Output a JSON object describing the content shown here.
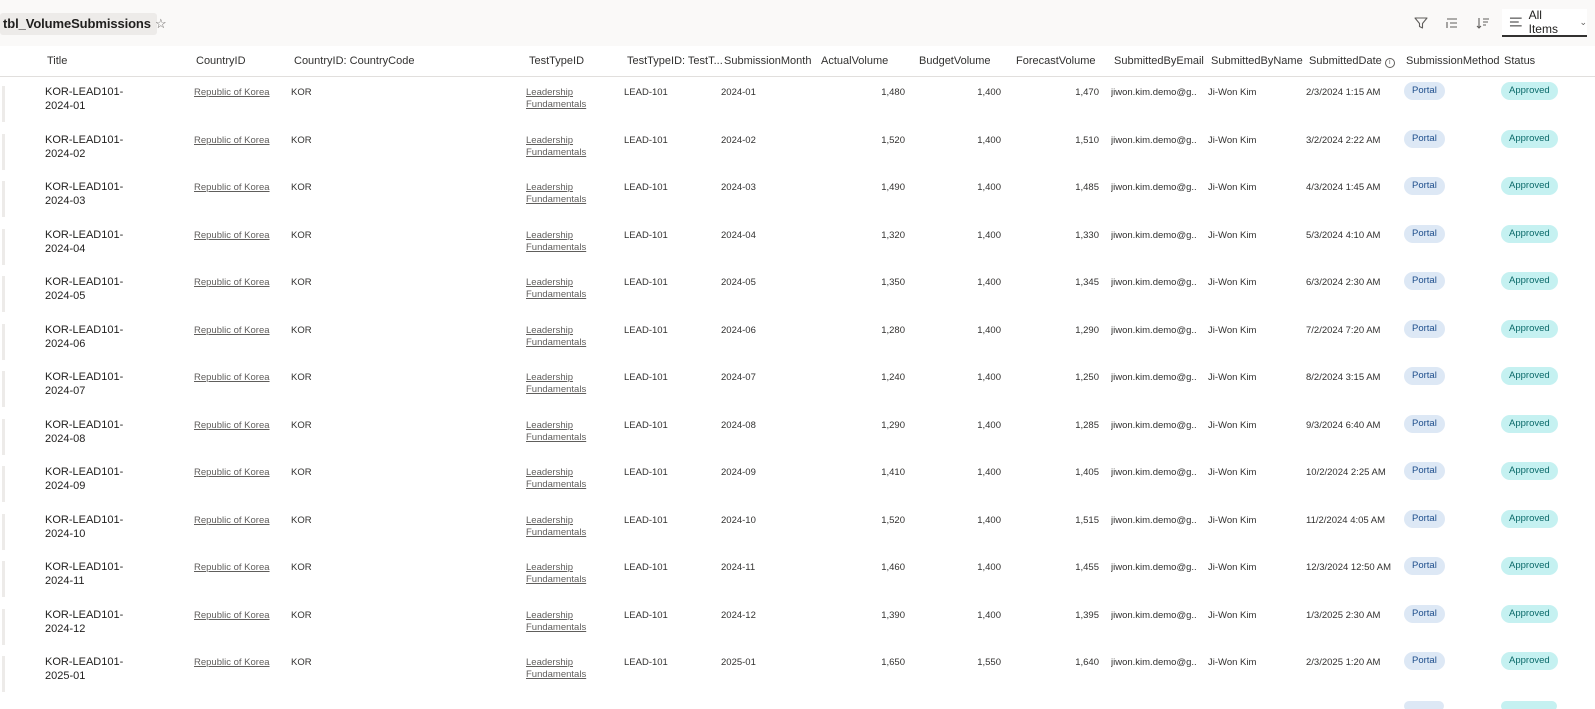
{
  "header": {
    "list_title": "tbl_VolumeSubmissions",
    "favorite_glyph": "☆",
    "view_label": "All Items",
    "icons": [
      "filter-icon",
      "group-by-icon",
      "sort-icon",
      "view-list-icon",
      "chevron-down-icon"
    ]
  },
  "columns": {
    "title": "Title",
    "country_id": "CountryID",
    "country_code": "CountryID: CountryCode",
    "test_type_id": "TestTypeID",
    "test_type_code": "TestTypeID: TestT...",
    "submission_month": "SubmissionMonth",
    "actual_volume": "ActualVolume",
    "budget_volume": "BudgetVolume",
    "forecast_volume": "ForecastVolume",
    "submitted_by_email": "SubmittedByEmail",
    "submitted_by_name": "SubmittedByName",
    "submitted_date": "SubmittedDate",
    "submission_method": "SubmissionMethod",
    "status": "Status"
  },
  "colors": {
    "portal_pill_bg": "#dde8f5",
    "approved_pill_bg": "#c5f1f1",
    "approved_text": "#0b6a6a"
  },
  "rows": [
    {
      "title_line1": "KOR-LEAD101-",
      "title_line2": "2024-01",
      "country": "Republic of Korea",
      "code": "KOR",
      "testtype_line1": "Leadership",
      "testtype_line2": "Fundamentals",
      "testcode": "LEAD-101",
      "month": "2024-01",
      "actual": "1,480",
      "budget": "1,400",
      "forecast": "1,470",
      "email": "jiwon.kim.demo@g...",
      "name": "Ji-Won Kim",
      "date": "2/3/2024 1:15 AM",
      "method": "Portal",
      "status": "Approved"
    },
    {
      "title_line1": "KOR-LEAD101-",
      "title_line2": "2024-02",
      "country": "Republic of Korea",
      "code": "KOR",
      "testtype_line1": "Leadership",
      "testtype_line2": "Fundamentals",
      "testcode": "LEAD-101",
      "month": "2024-02",
      "actual": "1,520",
      "budget": "1,400",
      "forecast": "1,510",
      "email": "jiwon.kim.demo@g...",
      "name": "Ji-Won Kim",
      "date": "3/2/2024 2:22 AM",
      "method": "Portal",
      "status": "Approved"
    },
    {
      "title_line1": "KOR-LEAD101-",
      "title_line2": "2024-03",
      "country": "Republic of Korea",
      "code": "KOR",
      "testtype_line1": "Leadership",
      "testtype_line2": "Fundamentals",
      "testcode": "LEAD-101",
      "month": "2024-03",
      "actual": "1,490",
      "budget": "1,400",
      "forecast": "1,485",
      "email": "jiwon.kim.demo@g...",
      "name": "Ji-Won Kim",
      "date": "4/3/2024 1:45 AM",
      "method": "Portal",
      "status": "Approved"
    },
    {
      "title_line1": "KOR-LEAD101-",
      "title_line2": "2024-04",
      "country": "Republic of Korea",
      "code": "KOR",
      "testtype_line1": "Leadership",
      "testtype_line2": "Fundamentals",
      "testcode": "LEAD-101",
      "month": "2024-04",
      "actual": "1,320",
      "budget": "1,400",
      "forecast": "1,330",
      "email": "jiwon.kim.demo@g...",
      "name": "Ji-Won Kim",
      "date": "5/3/2024 4:10 AM",
      "method": "Portal",
      "status": "Approved"
    },
    {
      "title_line1": "KOR-LEAD101-",
      "title_line2": "2024-05",
      "country": "Republic of Korea",
      "code": "KOR",
      "testtype_line1": "Leadership",
      "testtype_line2": "Fundamentals",
      "testcode": "LEAD-101",
      "month": "2024-05",
      "actual": "1,350",
      "budget": "1,400",
      "forecast": "1,345",
      "email": "jiwon.kim.demo@g...",
      "name": "Ji-Won Kim",
      "date": "6/3/2024 2:30 AM",
      "method": "Portal",
      "status": "Approved"
    },
    {
      "title_line1": "KOR-LEAD101-",
      "title_line2": "2024-06",
      "country": "Republic of Korea",
      "code": "KOR",
      "testtype_line1": "Leadership",
      "testtype_line2": "Fundamentals",
      "testcode": "LEAD-101",
      "month": "2024-06",
      "actual": "1,280",
      "budget": "1,400",
      "forecast": "1,290",
      "email": "jiwon.kim.demo@g...",
      "name": "Ji-Won Kim",
      "date": "7/2/2024 7:20 AM",
      "method": "Portal",
      "status": "Approved"
    },
    {
      "title_line1": "KOR-LEAD101-",
      "title_line2": "2024-07",
      "country": "Republic of Korea",
      "code": "KOR",
      "testtype_line1": "Leadership",
      "testtype_line2": "Fundamentals",
      "testcode": "LEAD-101",
      "month": "2024-07",
      "actual": "1,240",
      "budget": "1,400",
      "forecast": "1,250",
      "email": "jiwon.kim.demo@g...",
      "name": "Ji-Won Kim",
      "date": "8/2/2024 3:15 AM",
      "method": "Portal",
      "status": "Approved"
    },
    {
      "title_line1": "KOR-LEAD101-",
      "title_line2": "2024-08",
      "country": "Republic of Korea",
      "code": "KOR",
      "testtype_line1": "Leadership",
      "testtype_line2": "Fundamentals",
      "testcode": "LEAD-101",
      "month": "2024-08",
      "actual": "1,290",
      "budget": "1,400",
      "forecast": "1,285",
      "email": "jiwon.kim.demo@g...",
      "name": "Ji-Won Kim",
      "date": "9/3/2024 6:40 AM",
      "method": "Portal",
      "status": "Approved"
    },
    {
      "title_line1": "KOR-LEAD101-",
      "title_line2": "2024-09",
      "country": "Republic of Korea",
      "code": "KOR",
      "testtype_line1": "Leadership",
      "testtype_line2": "Fundamentals",
      "testcode": "LEAD-101",
      "month": "2024-09",
      "actual": "1,410",
      "budget": "1,400",
      "forecast": "1,405",
      "email": "jiwon.kim.demo@g...",
      "name": "Ji-Won Kim",
      "date": "10/2/2024 2:25 AM",
      "method": "Portal",
      "status": "Approved"
    },
    {
      "title_line1": "KOR-LEAD101-",
      "title_line2": "2024-10",
      "country": "Republic of Korea",
      "code": "KOR",
      "testtype_line1": "Leadership",
      "testtype_line2": "Fundamentals",
      "testcode": "LEAD-101",
      "month": "2024-10",
      "actual": "1,520",
      "budget": "1,400",
      "forecast": "1,515",
      "email": "jiwon.kim.demo@g...",
      "name": "Ji-Won Kim",
      "date": "11/2/2024 4:05 AM",
      "method": "Portal",
      "status": "Approved"
    },
    {
      "title_line1": "KOR-LEAD101-",
      "title_line2": "2024-11",
      "country": "Republic of Korea",
      "code": "KOR",
      "testtype_line1": "Leadership",
      "testtype_line2": "Fundamentals",
      "testcode": "LEAD-101",
      "month": "2024-11",
      "actual": "1,460",
      "budget": "1,400",
      "forecast": "1,455",
      "email": "jiwon.kim.demo@g...",
      "name": "Ji-Won Kim",
      "date": "12/3/2024 12:50 AM",
      "method": "Portal",
      "status": "Approved"
    },
    {
      "title_line1": "KOR-LEAD101-",
      "title_line2": "2024-12",
      "country": "Republic of Korea",
      "code": "KOR",
      "testtype_line1": "Leadership",
      "testtype_line2": "Fundamentals",
      "testcode": "LEAD-101",
      "month": "2024-12",
      "actual": "1,390",
      "budget": "1,400",
      "forecast": "1,395",
      "email": "jiwon.kim.demo@g...",
      "name": "Ji-Won Kim",
      "date": "1/3/2025 2:30 AM",
      "method": "Portal",
      "status": "Approved"
    },
    {
      "title_line1": "KOR-LEAD101-",
      "title_line2": "2025-01",
      "country": "Republic of Korea",
      "code": "KOR",
      "testtype_line1": "Leadership",
      "testtype_line2": "Fundamentals",
      "testcode": "LEAD-101",
      "month": "2025-01",
      "actual": "1,650",
      "budget": "1,550",
      "forecast": "1,640",
      "email": "jiwon.kim.demo@g...",
      "name": "Ji-Won Kim",
      "date": "2/3/2025 1:20 AM",
      "method": "Portal",
      "status": "Approved"
    }
  ]
}
